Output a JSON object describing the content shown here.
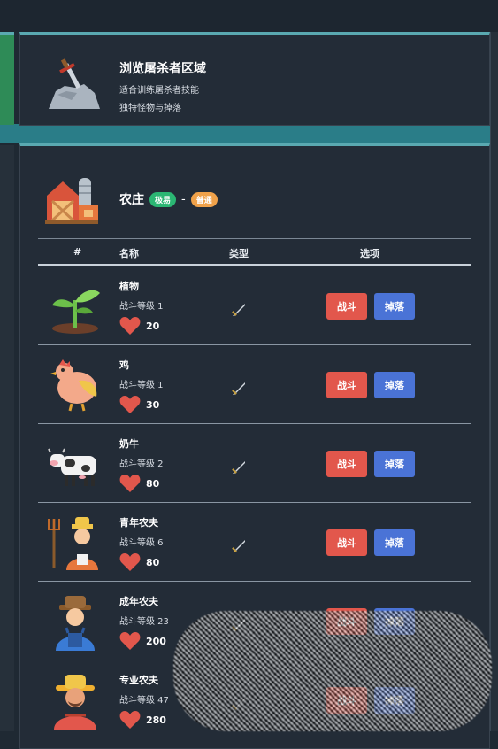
{
  "colors": {
    "fight": "#e2574c",
    "drop": "#4a73d6",
    "badge_green": "#2bb673",
    "badge_orange": "#f0a24a",
    "heart": "#e2574c",
    "accent": "#5aa9b1"
  },
  "area": {
    "title": "浏览屠杀者区域",
    "line1": "适合训练屠杀者技能",
    "line2": "独特怪物与掉落",
    "icon": "sword-in-stone-icon"
  },
  "zone": {
    "name": "农庄",
    "badge1": "极易",
    "separator": "-",
    "badge2": "普通",
    "icon": "barn-icon"
  },
  "table": {
    "headers": {
      "index": "#",
      "name": "名称",
      "type": "类型",
      "options": "选项"
    },
    "fight_label": "战斗",
    "drop_label": "掉落"
  },
  "monsters": [
    {
      "name": "植物",
      "level": "战斗等级 1",
      "hp": "20",
      "icon": "plant-icon"
    },
    {
      "name": "鸡",
      "level": "战斗等级 1",
      "hp": "30",
      "icon": "chicken-icon"
    },
    {
      "name": "奶牛",
      "level": "战斗等级 2",
      "hp": "80",
      "icon": "cow-icon"
    },
    {
      "name": "青年农夫",
      "level": "战斗等级 6",
      "hp": "80",
      "icon": "young-farmer-icon"
    },
    {
      "name": "成年农夫",
      "level": "战斗等级 23",
      "hp": "200",
      "icon": "adult-farmer-icon"
    },
    {
      "name": "专业农夫",
      "level": "战斗等级 47",
      "hp": "280",
      "icon": "pro-farmer-icon"
    }
  ]
}
